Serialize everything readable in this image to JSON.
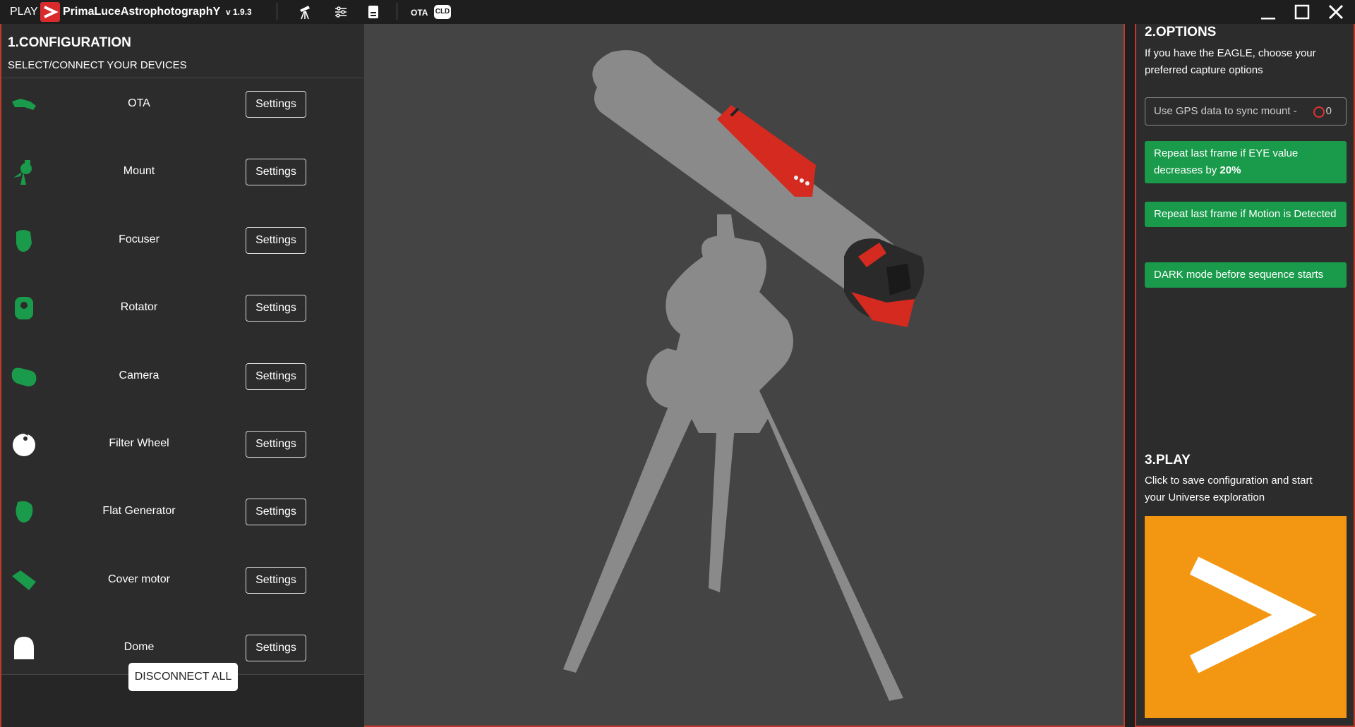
{
  "titlebar": {
    "play": "PLAY",
    "brand": "PrimaLuceAstrophotographY",
    "version": "v 1.9.3",
    "ota": "OTA",
    "cld": "CLD"
  },
  "config": {
    "title": "1.CONFIGURATION",
    "subtitle": "SELECT/CONNECT YOUR DEVICES",
    "settings_label": "Settings",
    "devices": [
      {
        "label": "OTA",
        "icon": "telescope-icon",
        "color": "#1a9b4b"
      },
      {
        "label": "Mount",
        "icon": "mount-icon",
        "color": "#1a9b4b"
      },
      {
        "label": "Focuser",
        "icon": "focuser-icon",
        "color": "#1a9b4b"
      },
      {
        "label": "Rotator",
        "icon": "rotator-icon",
        "color": "#1a9b4b"
      },
      {
        "label": "Camera",
        "icon": "camera-icon",
        "color": "#1a9b4b"
      },
      {
        "label": "Filter Wheel",
        "icon": "filter-wheel-icon",
        "color": "#ffffff"
      },
      {
        "label": "Flat Generator",
        "icon": "flat-generator-icon",
        "color": "#1a9b4b"
      },
      {
        "label": "Cover motor",
        "icon": "cover-motor-icon",
        "color": "#1a9b4b"
      },
      {
        "label": "Dome",
        "icon": "dome-icon",
        "color": "#ffffff"
      }
    ],
    "disconnect_label": "DISCONNECT ALL"
  },
  "options": {
    "title": "2.OPTIONS",
    "description": "If you have the EAGLE, choose your preferred capture options",
    "gps_label": "Use GPS data to sync mount  -",
    "gps_count": "0",
    "buttons": [
      {
        "label": "Repeat last frame if EYE value decreases by ",
        "bold": "20%"
      },
      {
        "label": "Repeat last frame if Motion is Detected",
        "bold": ""
      },
      {
        "label": "DARK mode before sequence starts",
        "bold": ""
      }
    ]
  },
  "play": {
    "title": "3.PLAY",
    "description": "Click to save configuration and start your Universe exploration"
  },
  "colors": {
    "accent_red": "#c0392b",
    "green": "#1a9b4b",
    "orange": "#f39712",
    "panel": "#2c2c2c",
    "viewer": "#444444"
  }
}
